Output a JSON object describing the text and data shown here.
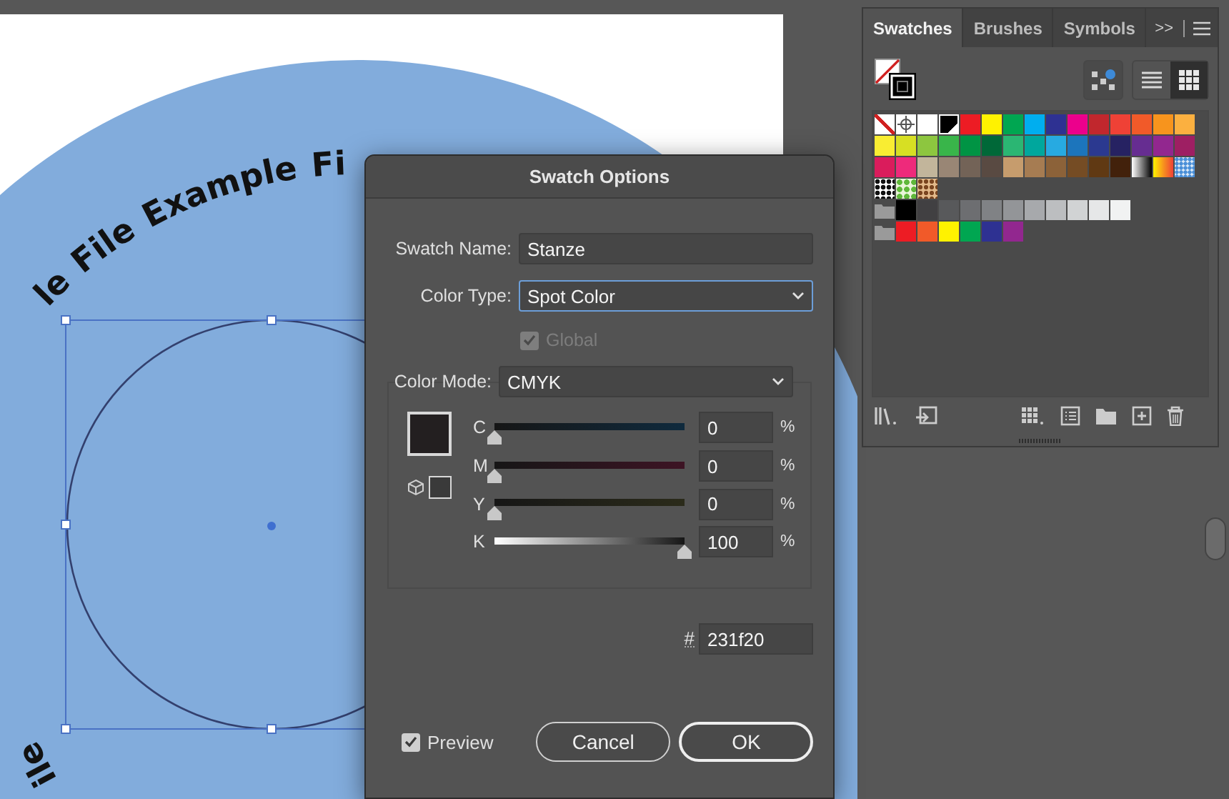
{
  "artwork": {
    "curved_text": [
      {
        "kind": "top",
        "text": "le File Example Fi"
      },
      {
        "kind": "bottom",
        "text": "ile"
      }
    ]
  },
  "panel": {
    "tabs": [
      {
        "label": "Swatches",
        "selected": true
      },
      {
        "label": "Brushes",
        "selected": false
      },
      {
        "label": "Symbols",
        "selected": false
      }
    ],
    "overflow": ">>",
    "view_buttons": [
      {
        "kind": "list",
        "selected": false
      },
      {
        "kind": "grid",
        "selected": true
      }
    ],
    "swatch_rows": [
      [
        {
          "kind": "none"
        },
        {
          "kind": "registration"
        },
        {
          "kind": "color",
          "color": "#ffffff"
        },
        {
          "kind": "spot",
          "color": "#000000"
        },
        {
          "kind": "color",
          "color": "#ed1c24"
        },
        {
          "kind": "color",
          "color": "#fff200"
        },
        {
          "kind": "color",
          "color": "#00a651"
        },
        {
          "kind": "color",
          "color": "#00aeef"
        },
        {
          "kind": "color",
          "color": "#2e3192"
        },
        {
          "kind": "color",
          "color": "#ec008c"
        },
        {
          "kind": "color",
          "color": "#c1272d"
        },
        {
          "kind": "color",
          "color": "#ef4136"
        },
        {
          "kind": "color",
          "color": "#f15a29"
        },
        {
          "kind": "color",
          "color": "#f7941d"
        },
        {
          "kind": "color",
          "color": "#fbb040"
        }
      ],
      [
        {
          "kind": "color",
          "color": "#f9ed32"
        },
        {
          "kind": "color",
          "color": "#d7df23"
        },
        {
          "kind": "color",
          "color": "#8dc63f"
        },
        {
          "kind": "color",
          "color": "#39b54a"
        },
        {
          "kind": "color",
          "color": "#009444"
        },
        {
          "kind": "color",
          "color": "#006838"
        },
        {
          "kind": "color",
          "color": "#2bb673"
        },
        {
          "kind": "color",
          "color": "#00a79d"
        },
        {
          "kind": "color",
          "color": "#27aae1"
        },
        {
          "kind": "color",
          "color": "#1c75bc"
        },
        {
          "kind": "color",
          "color": "#2b3990"
        },
        {
          "kind": "color",
          "color": "#262262"
        },
        {
          "kind": "color",
          "color": "#662d91"
        },
        {
          "kind": "color",
          "color": "#92278f"
        },
        {
          "kind": "color",
          "color": "#9e1f63"
        }
      ],
      [
        {
          "kind": "color",
          "color": "#da1c5c"
        },
        {
          "kind": "color",
          "color": "#ee2a7b"
        },
        {
          "kind": "color",
          "color": "#c2b59b"
        },
        {
          "kind": "color",
          "color": "#998675"
        },
        {
          "kind": "color",
          "color": "#736357"
        },
        {
          "kind": "color",
          "color": "#594a42"
        },
        {
          "kind": "color",
          "color": "#c69c6d"
        },
        {
          "kind": "color",
          "color": "#a67c52"
        },
        {
          "kind": "color",
          "color": "#8c6239"
        },
        {
          "kind": "color",
          "color": "#754c24"
        },
        {
          "kind": "color",
          "color": "#603913"
        },
        {
          "kind": "color",
          "color": "#42210b"
        },
        {
          "kind": "fade"
        },
        {
          "kind": "gradient"
        },
        {
          "kind": "halftone"
        }
      ],
      [
        {
          "kind": "dots"
        },
        {
          "kind": "leaves"
        },
        {
          "kind": "leopard"
        }
      ],
      [
        {
          "kind": "folder"
        },
        {
          "kind": "color",
          "color": "#000000"
        },
        {
          "kind": "color",
          "color": "#414042"
        },
        {
          "kind": "color",
          "color": "#58595b"
        },
        {
          "kind": "color",
          "color": "#6d6e71"
        },
        {
          "kind": "color",
          "color": "#808285"
        },
        {
          "kind": "color",
          "color": "#939598"
        },
        {
          "kind": "color",
          "color": "#a7a9ac"
        },
        {
          "kind": "color",
          "color": "#bcbec0"
        },
        {
          "kind": "color",
          "color": "#d1d3d4"
        },
        {
          "kind": "color",
          "color": "#e6e7e8"
        },
        {
          "kind": "color",
          "color": "#f1f2f2"
        }
      ],
      [
        {
          "kind": "folder"
        },
        {
          "kind": "color",
          "color": "#ed1c24"
        },
        {
          "kind": "color",
          "color": "#f15a29"
        },
        {
          "kind": "color",
          "color": "#fff200"
        },
        {
          "kind": "color",
          "color": "#00a651"
        },
        {
          "kind": "color",
          "color": "#2e3192"
        },
        {
          "kind": "color",
          "color": "#92278f"
        }
      ]
    ]
  },
  "dialog": {
    "title": "Swatch Options",
    "swatch_name": {
      "label": "Swatch Name:",
      "value": "Stanze"
    },
    "color_type": {
      "label": "Color Type:",
      "value": "Spot Color",
      "focused": true
    },
    "global": {
      "label": "Global",
      "checked": true,
      "disabled": true
    },
    "color_mode": {
      "label": "Color Mode:",
      "value": "CMYK"
    },
    "channels": [
      {
        "kind": "cyan",
        "label": "C",
        "level": 0,
        "value": "0",
        "unit": "%"
      },
      {
        "kind": "magenta",
        "label": "M",
        "level": 0,
        "value": "0",
        "unit": "%"
      },
      {
        "kind": "yellow",
        "label": "Y",
        "level": 0,
        "value": "0",
        "unit": "%"
      },
      {
        "kind": "black",
        "label": "K",
        "level": 1,
        "value": "100",
        "unit": "%"
      }
    ],
    "hex": {
      "label": "#",
      "value": "231f20"
    },
    "preview": {
      "label": "Preview",
      "checked": true
    },
    "buttons": [
      {
        "kind": "cancel",
        "label": "Cancel"
      },
      {
        "kind": "default",
        "label": "OK"
      }
    ]
  }
}
